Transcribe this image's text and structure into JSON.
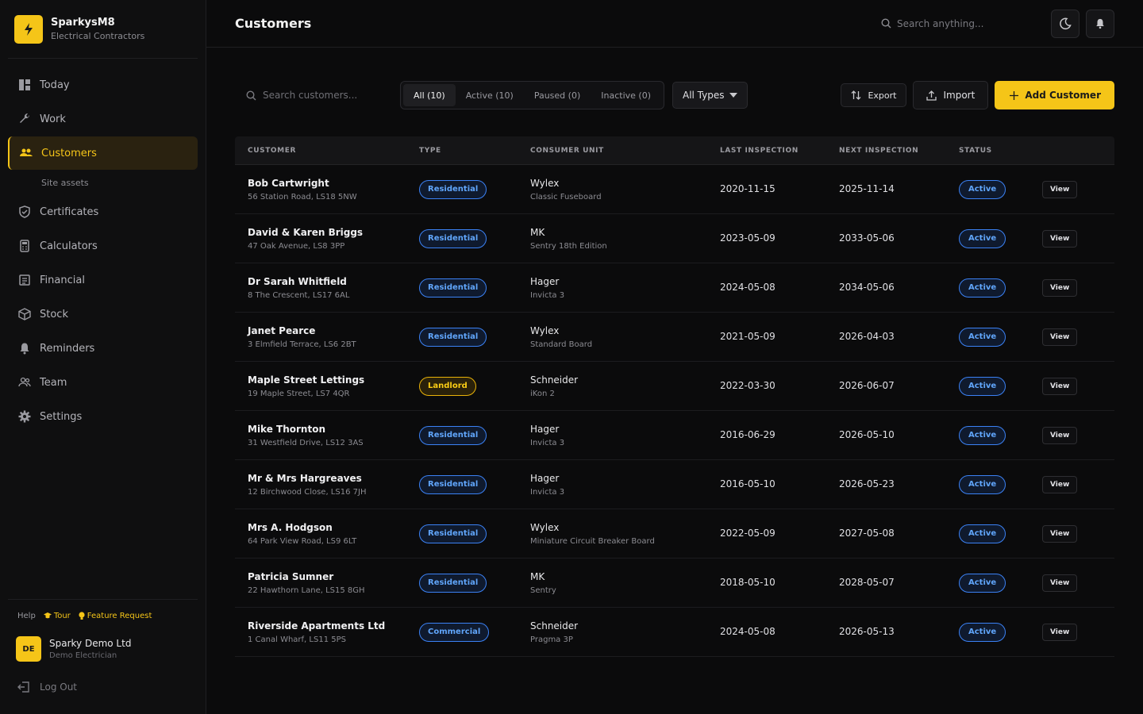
{
  "brand": {
    "name": "SparkysM8",
    "subtitle": "Electrical Contractors",
    "logo_icon": "lightning-icon",
    "accent": "#f5c518"
  },
  "nav": {
    "items": [
      {
        "label": "Today",
        "icon": "dashboard-icon"
      },
      {
        "label": "Work",
        "icon": "wrench-icon"
      },
      {
        "label": "Customers",
        "icon": "users-icon",
        "active": true
      },
      {
        "label": "Site assets",
        "sub": true
      },
      {
        "label": "Certificates",
        "icon": "shield-icon"
      },
      {
        "label": "Calculators",
        "icon": "calculator-icon"
      },
      {
        "label": "Financial",
        "icon": "receipt-icon"
      },
      {
        "label": "Stock",
        "icon": "box-icon"
      },
      {
        "label": "Reminders",
        "icon": "bell-icon"
      },
      {
        "label": "Team",
        "icon": "team-icon"
      },
      {
        "label": "Settings",
        "icon": "gear-icon"
      }
    ]
  },
  "footer": {
    "help": "Help",
    "tour": "Tour",
    "feature_request": "Feature Request",
    "user_initials": "DE",
    "user_name": "Sparky Demo Ltd",
    "user_role": "Demo Electrician",
    "logout": "Log Out"
  },
  "header": {
    "title": "Customers",
    "search_placeholder": "Search anything..."
  },
  "toolbar": {
    "search_placeholder": "Search customers...",
    "segments": [
      "All (10)",
      "Active (10)",
      "Paused (0)",
      "Inactive (0)"
    ],
    "active_segment": "All (10)",
    "type_filter": "All Types",
    "export": "Export",
    "import": "Import",
    "add": "Add Customer"
  },
  "table": {
    "columns": [
      "CUSTOMER",
      "TYPE",
      "CONSUMER UNIT",
      "LAST INSPECTION",
      "NEXT INSPECTION",
      "STATUS"
    ],
    "view_label": "View",
    "rows": [
      {
        "name": "Bob Cartwright",
        "address": "56 Station Road, LS18 5NW",
        "type": "Residential",
        "cu_brand": "Wylex",
        "cu_model": "Classic Fuseboard",
        "last": "2020-11-15",
        "next": "2025-11-14",
        "status": "Active"
      },
      {
        "name": "David & Karen Briggs",
        "address": "47 Oak Avenue, LS8 3PP",
        "type": "Residential",
        "cu_brand": "MK",
        "cu_model": "Sentry 18th Edition",
        "last": "2023-05-09",
        "next": "2033-05-06",
        "status": "Active"
      },
      {
        "name": "Dr Sarah Whitfield",
        "address": "8 The Crescent, LS17 6AL",
        "type": "Residential",
        "cu_brand": "Hager",
        "cu_model": "Invicta 3",
        "last": "2024-05-08",
        "next": "2034-05-06",
        "status": "Active"
      },
      {
        "name": "Janet Pearce",
        "address": "3 Elmfield Terrace, LS6 2BT",
        "type": "Residential",
        "cu_brand": "Wylex",
        "cu_model": "Standard Board",
        "last": "2021-05-09",
        "next": "2026-04-03",
        "status": "Active"
      },
      {
        "name": "Maple Street Lettings",
        "address": "19 Maple Street, LS7 4QR",
        "type": "Landlord",
        "cu_brand": "Schneider",
        "cu_model": "iKon 2",
        "last": "2022-03-30",
        "next": "2026-06-07",
        "status": "Active"
      },
      {
        "name": "Mike Thornton",
        "address": "31 Westfield Drive, LS12 3AS",
        "type": "Residential",
        "cu_brand": "Hager",
        "cu_model": "Invicta 3",
        "last": "2016-06-29",
        "next": "2026-05-10",
        "status": "Active"
      },
      {
        "name": "Mr & Mrs Hargreaves",
        "address": "12 Birchwood Close, LS16 7JH",
        "type": "Residential",
        "cu_brand": "Hager",
        "cu_model": "Invicta 3",
        "last": "2016-05-10",
        "next": "2026-05-23",
        "status": "Active"
      },
      {
        "name": "Mrs A. Hodgson",
        "address": "64 Park View Road, LS9 6LT",
        "type": "Residential",
        "cu_brand": "Wylex",
        "cu_model": "Miniature Circuit Breaker Board",
        "last": "2022-05-09",
        "next": "2027-05-08",
        "status": "Active"
      },
      {
        "name": "Patricia Sumner",
        "address": "22 Hawthorn Lane, LS15 8GH",
        "type": "Residential",
        "cu_brand": "MK",
        "cu_model": "Sentry",
        "last": "2018-05-10",
        "next": "2028-05-07",
        "status": "Active"
      },
      {
        "name": "Riverside Apartments Ltd",
        "address": "1 Canal Wharf, LS11 5PS",
        "type": "Commercial",
        "cu_brand": "Schneider",
        "cu_model": "Pragma 3P",
        "last": "2024-05-08",
        "next": "2026-05-13",
        "status": "Active"
      }
    ]
  }
}
